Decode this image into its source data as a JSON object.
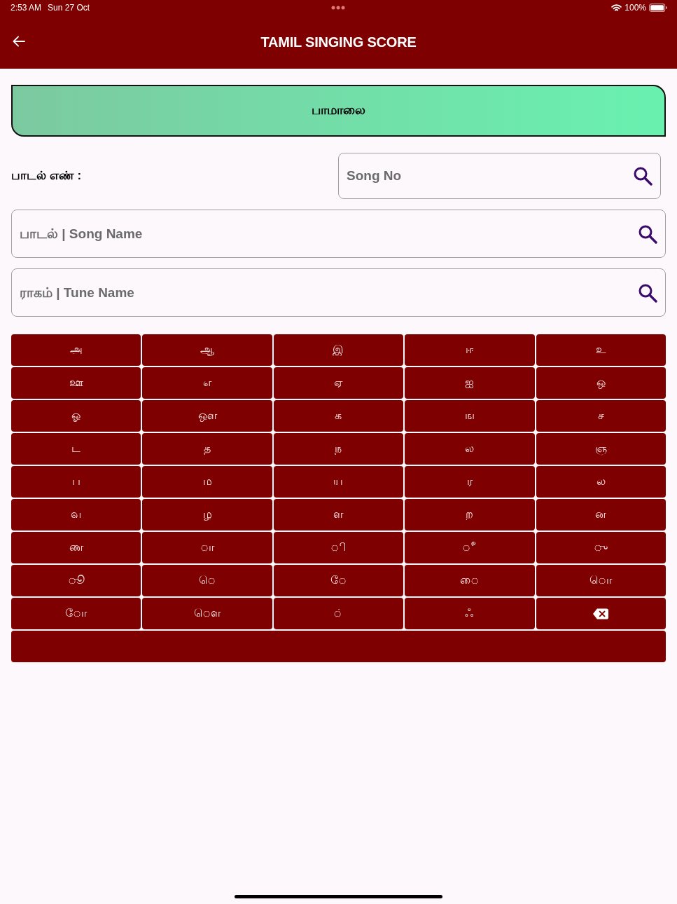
{
  "status_bar": {
    "time": "2:53 AM",
    "date": "Sun 27 Oct",
    "battery": "100%"
  },
  "header": {
    "title": "TAMIL SINGING SCORE"
  },
  "banner": {
    "title": "பாமாலை"
  },
  "song_number": {
    "label": "பாடல் எண் :",
    "placeholder": "Song No"
  },
  "fields": [
    {
      "placeholder": "பாடல் | Song Name"
    },
    {
      "placeholder": "ராகம் | Tune Name"
    }
  ],
  "keyboard": {
    "keys": [
      {
        "kind": "char",
        "label": "அ"
      },
      {
        "kind": "char",
        "label": "ஆ"
      },
      {
        "kind": "char",
        "label": "இ"
      },
      {
        "kind": "char",
        "label": "ஈ"
      },
      {
        "kind": "char",
        "label": "உ"
      },
      {
        "kind": "char",
        "label": "ஊ"
      },
      {
        "kind": "char",
        "label": "எ"
      },
      {
        "kind": "char",
        "label": "ஏ"
      },
      {
        "kind": "char",
        "label": "ஐ"
      },
      {
        "kind": "char",
        "label": "ஒ"
      },
      {
        "kind": "char",
        "label": "ஓ"
      },
      {
        "kind": "char",
        "label": "ஔ"
      },
      {
        "kind": "char",
        "label": "க"
      },
      {
        "kind": "char",
        "label": "ங"
      },
      {
        "kind": "char",
        "label": "ச"
      },
      {
        "kind": "char",
        "label": "ட"
      },
      {
        "kind": "char",
        "label": "த"
      },
      {
        "kind": "char",
        "label": "ந"
      },
      {
        "kind": "char",
        "label": "ல"
      },
      {
        "kind": "char",
        "label": "ஞ"
      },
      {
        "kind": "char",
        "label": "ப"
      },
      {
        "kind": "char",
        "label": "ம"
      },
      {
        "kind": "char",
        "label": "ய"
      },
      {
        "kind": "char",
        "label": "ர"
      },
      {
        "kind": "char",
        "label": "ல"
      },
      {
        "kind": "char",
        "label": "வ"
      },
      {
        "kind": "char",
        "label": "ழ"
      },
      {
        "kind": "char",
        "label": "ள"
      },
      {
        "kind": "char",
        "label": "ற"
      },
      {
        "kind": "char",
        "label": "ன"
      },
      {
        "kind": "char",
        "label": "ண"
      },
      {
        "kind": "char",
        "label": "ா"
      },
      {
        "kind": "char",
        "label": "ி"
      },
      {
        "kind": "char",
        "label": "ீ"
      },
      {
        "kind": "char",
        "label": "ு"
      },
      {
        "kind": "char",
        "label": "ூ"
      },
      {
        "kind": "char",
        "label": "ெ"
      },
      {
        "kind": "char",
        "label": "ே"
      },
      {
        "kind": "char",
        "label": "ை"
      },
      {
        "kind": "char",
        "label": "ொ"
      },
      {
        "kind": "char",
        "label": "ோ"
      },
      {
        "kind": "char",
        "label": "ௌ"
      },
      {
        "kind": "char",
        "label": "்"
      },
      {
        "kind": "char",
        "label": "ஃ"
      },
      {
        "kind": "backspace"
      },
      {
        "kind": "space"
      }
    ]
  }
}
